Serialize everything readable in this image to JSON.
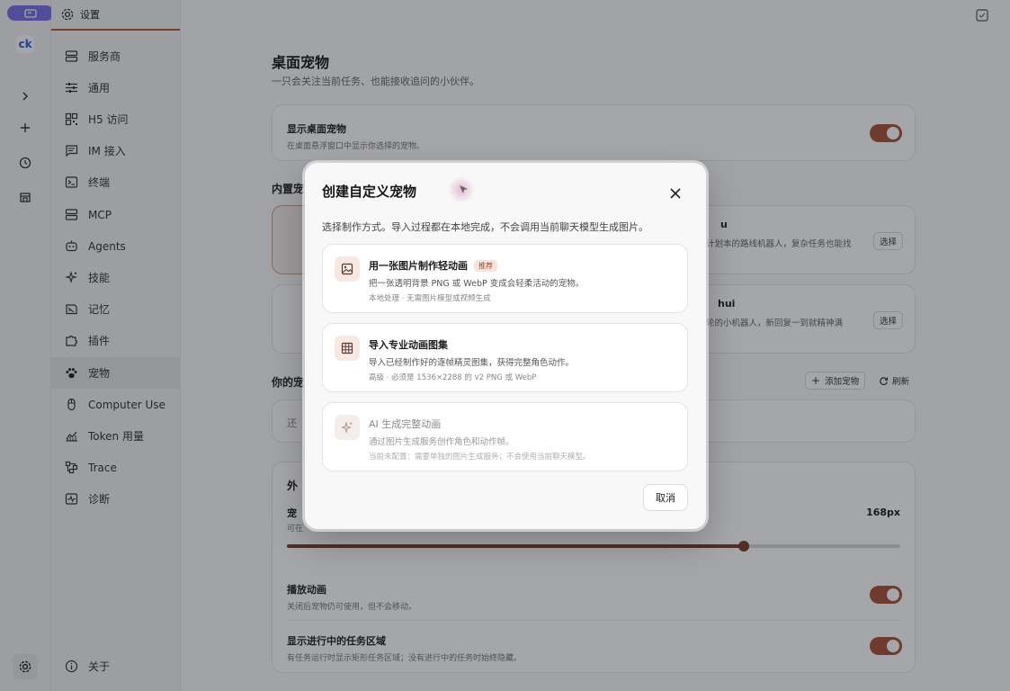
{
  "sidebar": {
    "header": "设置",
    "items": [
      {
        "label": "服务商",
        "icon": "server-icon"
      },
      {
        "label": "通用",
        "icon": "sliders-icon"
      },
      {
        "label": "H5 访问",
        "icon": "qr-icon"
      },
      {
        "label": "IM 接入",
        "icon": "chat-icon"
      },
      {
        "label": "终端",
        "icon": "terminal-icon"
      },
      {
        "label": "MCP",
        "icon": "server-icon"
      },
      {
        "label": "Agents",
        "icon": "robot-icon"
      },
      {
        "label": "技能",
        "icon": "sparkle-icon"
      },
      {
        "label": "记忆",
        "icon": "memory-icon"
      },
      {
        "label": "插件",
        "icon": "puzzle-icon"
      },
      {
        "label": "宠物",
        "icon": "paw-icon"
      },
      {
        "label": "Computer Use",
        "icon": "mouse-icon"
      },
      {
        "label": "Token 用量",
        "icon": "chart-icon"
      },
      {
        "label": "Trace",
        "icon": "trace-icon"
      },
      {
        "label": "诊断",
        "icon": "pulse-icon"
      }
    ],
    "active_index": 10,
    "footer": "关于"
  },
  "rail": {
    "logo": "ck"
  },
  "main": {
    "title": "桌面宠物",
    "subtitle": "一只会关注当前任务、也能接收追问的小伙伴。",
    "show_pet": {
      "title": "显示桌面宠物",
      "desc": "在桌面悬浮窗口中显示你选择的宠物。"
    },
    "builtin_title": "内置宠",
    "builtin_right_1": {
      "name": "u",
      "desc": "计划本的路线机器人，复杂任务也能找",
      "select": "选择"
    },
    "builtin_right_2": {
      "name": "hui",
      "desc": "轮的小机器人，新回复一到就精神满",
      "select": "选择"
    },
    "your_pets_title": "你的宠",
    "add_pet": "添加宠物",
    "refresh": "刷新",
    "your_pets_empty": "还",
    "appearance_title": "外",
    "size_label": "宠",
    "size_desc": "可在",
    "size_value": "168px",
    "size_fraction": 0.745,
    "play_anim": {
      "title": "播放动画",
      "desc": "关闭后宠物仍可使用，但不会移动。"
    },
    "show_task": {
      "title": "显示进行中的任务区域",
      "desc": "有任务运行时显示矩形任务区域；没有进行中的任务时始终隐藏。"
    }
  },
  "dialog": {
    "title": "创建自定义宠物",
    "desc": "选择制作方式。导入过程都在本地完成，不会调用当前聊天模型生成图片。",
    "options": [
      {
        "title": "用一张图片制作轻动画",
        "badge": "推荐",
        "desc": "把一张透明背景 PNG 或 WebP 变成会轻柔活动的宠物。",
        "meta": "本地处理 · 无需图片模型或视频生成",
        "icon": "image-icon"
      },
      {
        "title": "导入专业动画图集",
        "desc": "导入已经制作好的逐帧精灵图集，获得完整角色动作。",
        "meta": "高级 · 必须是 1536×2288 的 v2 PNG 或 WebP",
        "icon": "grid-icon"
      },
      {
        "title": "AI 生成完整动画",
        "desc": "通过图片生成服务创作角色和动作帧。",
        "meta": "当前未配置：需要单独的图片生成服务；不会使用当前聊天模型。",
        "icon": "sparkle-icon"
      }
    ],
    "cancel": "取消"
  },
  "colors": {
    "accent": "#a9533a",
    "active_bg": "#e6e6e6",
    "rail_btn": "#7a70e6"
  }
}
